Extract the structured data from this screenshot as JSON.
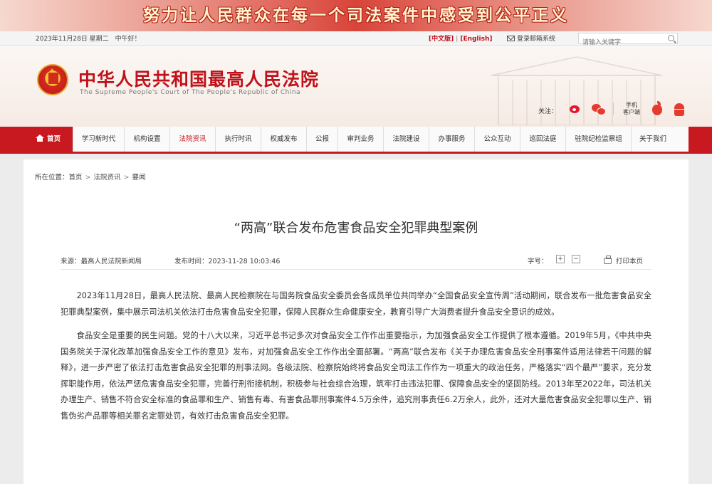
{
  "slogan": "努力让人民群众在每一个司法案件中感受到公平正义",
  "topbar": {
    "date": "2023年11月28日 星期二　中午好！",
    "lang_cn": "中文版",
    "lang_en": "English",
    "mail": "登录邮箱系统",
    "search_placeholder": "请输入关键字"
  },
  "header": {
    "title": "中华人民共和国最高人民法院",
    "subtitle": "The Supreme People's Court of The People's Republic of China",
    "follow_label": "关注：",
    "client_label": "手机\n客户端"
  },
  "nav": {
    "items": [
      "首页",
      "学习新时代",
      "机构设置",
      "法院资讯",
      "执行时讯",
      "权威发布",
      "公报",
      "审判业务",
      "法院建设",
      "办事服务",
      "公众互动",
      "巡回法庭",
      "驻院纪检监察组",
      "关于我们"
    ],
    "active": "法院资讯"
  },
  "breadcrumb": {
    "label": "所在位置：",
    "items": [
      "首页",
      "法院资讯",
      "要闻"
    ]
  },
  "article": {
    "title": "“两高”联合发布危害食品安全犯罪典型案例",
    "source": "来源：最高人民法院新闻局",
    "pub_time": "发布时间：2023-11-28 10:03:46",
    "font_size_label": "字号：",
    "zoom_in": "+",
    "zoom_out": "−",
    "print": "打印本页",
    "paragraphs": [
      "2023年11月28日，最高人民法院、最高人民检察院在与国务院食品安全委员会各成员单位共同举办“全国食品安全宣传周”活动期间，联合发布一批危害食品安全犯罪典型案例，集中展示司法机关依法打击危害食品安全犯罪，保障人民群众生命健康安全，教育引导广大消费者提升食品安全意识的成效。",
      "食品安全是重要的民生问题。党的十八大以来，习近平总书记多次对食品安全工作作出重要指示，为加强食品安全工作提供了根本遵循。2019年5月，《中共中央国务院关于深化改革加强食品安全工作的意见》发布，对加强食品安全工作作出全面部署。“两高”联合发布《关于办理危害食品安全刑事案件适用法律若干问题的解释》，进一步严密了依法打击危害食品安全犯罪的刑事法网。各级法院、检察院始终将食品安全司法工作作为一项重大的政治任务，严格落实“四个最严”要求，充分发挥职能作用，依法严惩危害食品安全犯罪，完善行刑衔接机制，积极参与社会综合治理，筑牢打击违法犯罪、保障食品安全的坚固防线。2013年至2022年，司法机关办理生产、销售不符合安全标准的食品罪和生产、销售有毒、有害食品罪刑事案件4.5万余件，追究刑事责任6.2万余人，此外，还对大量危害食品安全犯罪以生产、销售伪劣产品罪等相关罪名定罪处罚，有效打击危害食品安全犯罪。"
    ]
  },
  "colors": {
    "brand_red": "#c7191f",
    "slogan_text": "#fff6d0"
  }
}
